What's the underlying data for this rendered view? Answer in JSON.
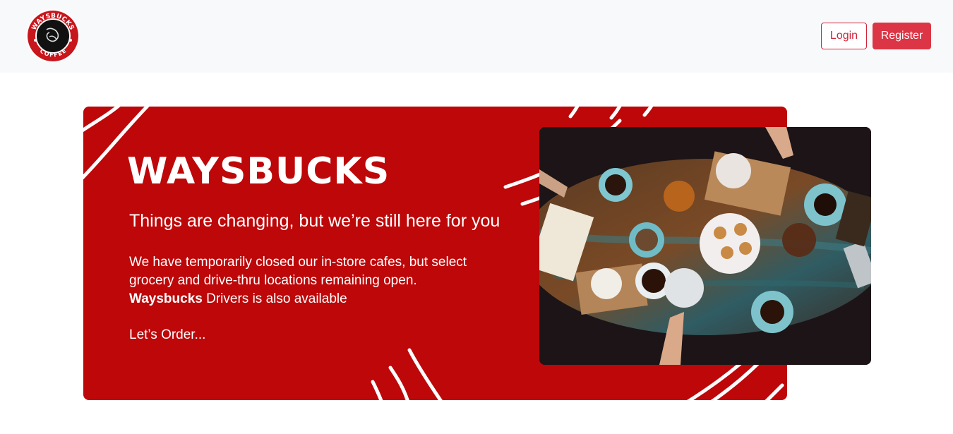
{
  "navbar": {
    "logo": {
      "top_text": "WAYSBUCKS",
      "bottom_text": "COFFEE",
      "icon": "waysbucks-logo-icon"
    },
    "login_label": "Login",
    "register_label": "Register"
  },
  "hero": {
    "brand": "WAYSBUCKS",
    "tagline": "Things are changing, but we’re still here for you",
    "description_line1": "We have temporarily closed our in-store cafes, but select",
    "description_line2": "grocery and drive-thru locations remaining open.",
    "description_brand": "Waysbucks",
    "description_line3": " Drivers is also available",
    "cta": "Let’s Order...",
    "image_icon": "coffee-table-photo"
  },
  "colors": {
    "navbar_bg": "#f8f9fb",
    "accent": "#dc3545",
    "hero_bg": "#bd0709",
    "text_light": "#ffffff"
  }
}
